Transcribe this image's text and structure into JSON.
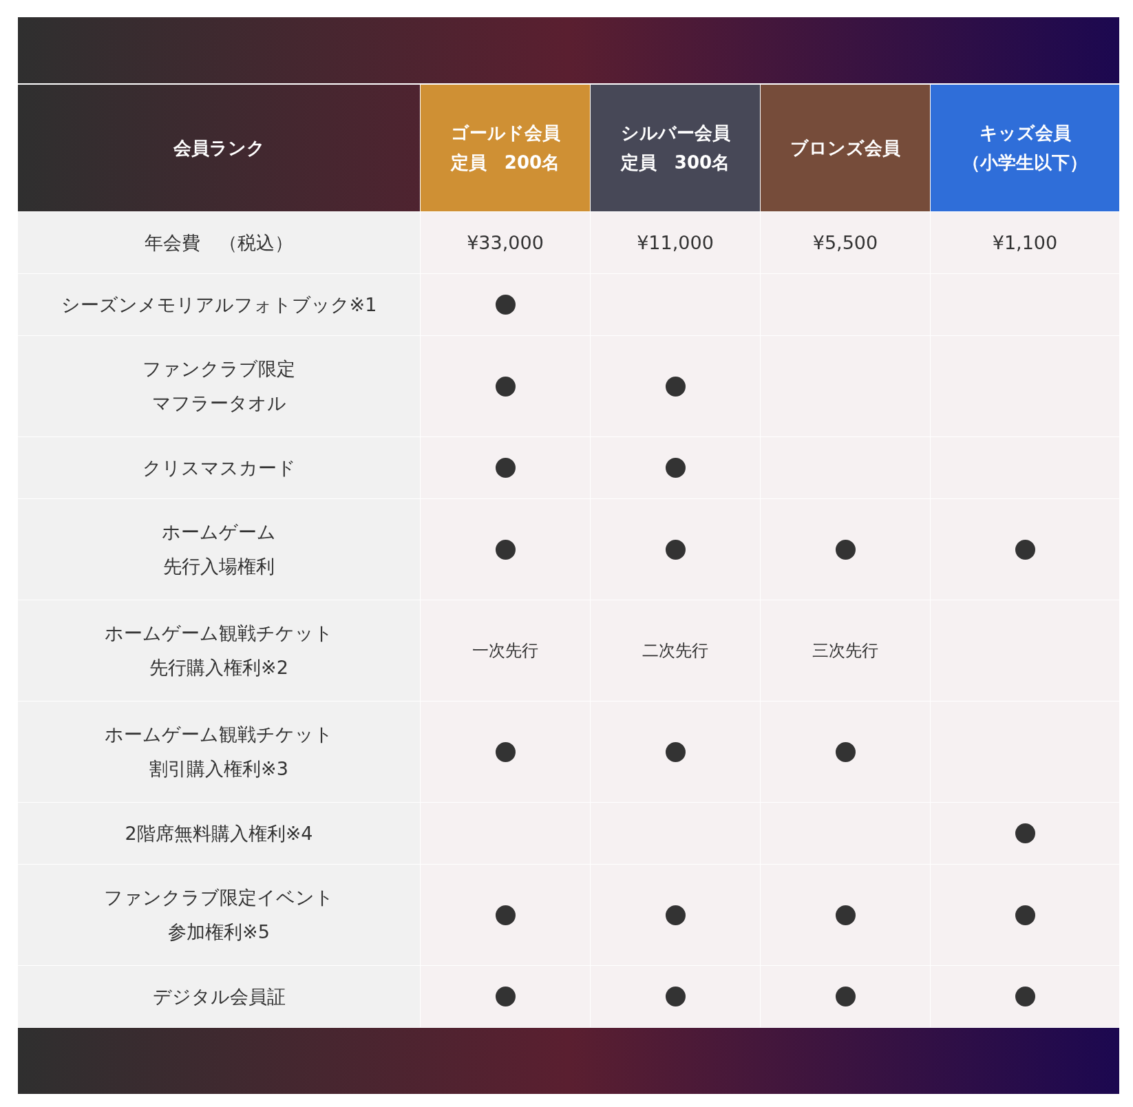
{
  "table": {
    "corner": "会員ランク",
    "columns": [
      {
        "lines": [
          "ゴールド会員",
          "定員　200名"
        ],
        "color": "#cf9034"
      },
      {
        "lines": [
          "シルバー会員",
          "定員　300名"
        ],
        "color": "#474857"
      },
      {
        "lines": [
          "ブロンズ会員"
        ],
        "color": "#764c3a"
      },
      {
        "lines": [
          "キッズ会員",
          "（小学生以下）"
        ],
        "color": "#2f6ed9"
      }
    ],
    "rows": [
      {
        "lines": [
          "年会費　（税込）"
        ],
        "cells": [
          {
            "kind": "text",
            "text": "¥33,000"
          },
          {
            "kind": "text",
            "text": "¥11,000"
          },
          {
            "kind": "text",
            "text": "¥5,500"
          },
          {
            "kind": "text",
            "text": "¥1,100"
          }
        ]
      },
      {
        "lines": [
          "シーズンメモリアルフォトブック※1"
        ],
        "cells": [
          {
            "kind": "dot"
          },
          {
            "kind": "empty"
          },
          {
            "kind": "empty"
          },
          {
            "kind": "empty"
          }
        ]
      },
      {
        "lines": [
          "ファンクラブ限定",
          "マフラータオル"
        ],
        "cells": [
          {
            "kind": "dot"
          },
          {
            "kind": "dot"
          },
          {
            "kind": "empty"
          },
          {
            "kind": "empty"
          }
        ]
      },
      {
        "lines": [
          "クリスマスカード"
        ],
        "cells": [
          {
            "kind": "dot"
          },
          {
            "kind": "dot"
          },
          {
            "kind": "empty"
          },
          {
            "kind": "empty"
          }
        ]
      },
      {
        "lines": [
          "ホームゲーム",
          "先行入場権利"
        ],
        "cells": [
          {
            "kind": "dot"
          },
          {
            "kind": "dot"
          },
          {
            "kind": "dot"
          },
          {
            "kind": "dot"
          }
        ]
      },
      {
        "lines": [
          "ホームゲーム観戦チケット",
          "先行購入権利※2"
        ],
        "cells": [
          {
            "kind": "note",
            "text": "一次先行"
          },
          {
            "kind": "note",
            "text": "二次先行"
          },
          {
            "kind": "note",
            "text": "三次先行"
          },
          {
            "kind": "empty"
          }
        ]
      },
      {
        "lines": [
          "ホームゲーム観戦チケット",
          "割引購入権利※3"
        ],
        "cells": [
          {
            "kind": "dot"
          },
          {
            "kind": "dot"
          },
          {
            "kind": "dot"
          },
          {
            "kind": "empty"
          }
        ]
      },
      {
        "lines": [
          "2階席無料購入権利※4"
        ],
        "cells": [
          {
            "kind": "empty"
          },
          {
            "kind": "empty"
          },
          {
            "kind": "empty"
          },
          {
            "kind": "dot"
          }
        ]
      },
      {
        "lines": [
          "ファンクラブ限定イベント",
          "参加権利※5"
        ],
        "cells": [
          {
            "kind": "dot"
          },
          {
            "kind": "dot"
          },
          {
            "kind": "dot"
          },
          {
            "kind": "dot"
          }
        ]
      },
      {
        "lines": [
          "デジタル会員証"
        ],
        "cells": [
          {
            "kind": "dot"
          },
          {
            "kind": "dot"
          },
          {
            "kind": "dot"
          },
          {
            "kind": "dot"
          }
        ]
      }
    ]
  }
}
